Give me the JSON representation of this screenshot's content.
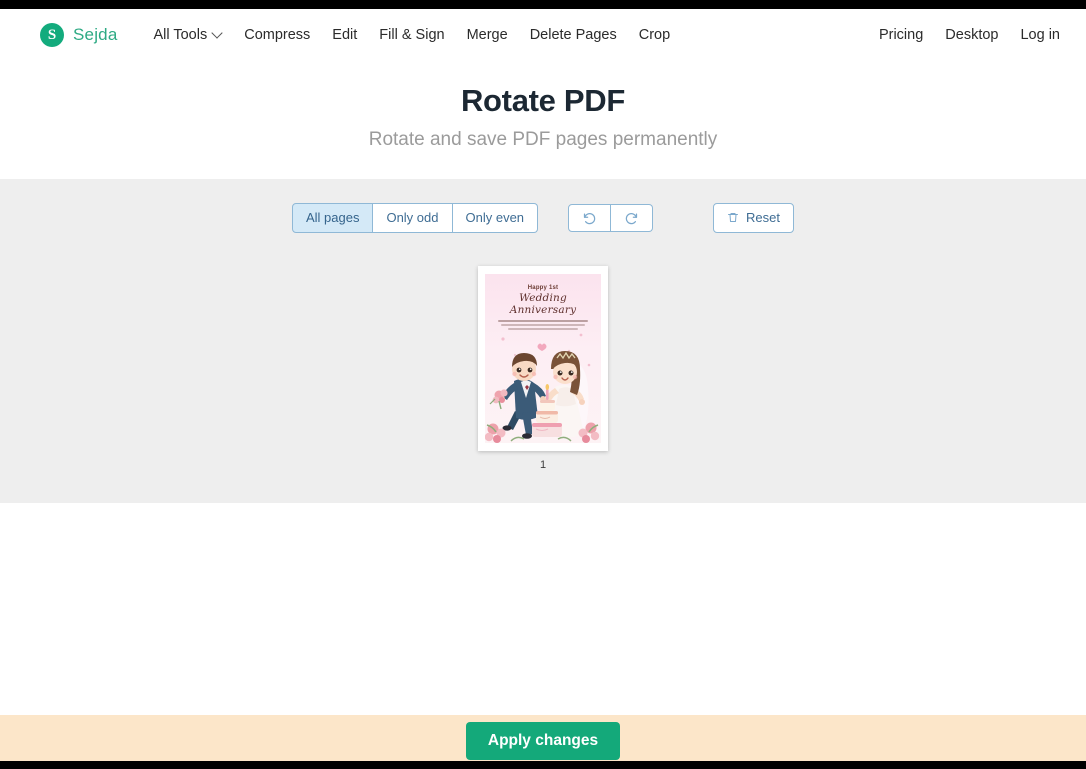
{
  "brand": {
    "mark": "S",
    "name": "Sejda",
    "logo_color": "#13ab7d"
  },
  "nav": {
    "left": [
      {
        "label": "All Tools",
        "has_dropdown": true,
        "icon": "chevron-down-icon"
      },
      {
        "label": "Compress",
        "has_dropdown": false
      },
      {
        "label": "Edit",
        "has_dropdown": false
      },
      {
        "label": "Fill & Sign",
        "has_dropdown": false
      },
      {
        "label": "Merge",
        "has_dropdown": false
      },
      {
        "label": "Delete Pages",
        "has_dropdown": false
      },
      {
        "label": "Crop",
        "has_dropdown": false
      }
    ],
    "right": [
      {
        "label": "Pricing"
      },
      {
        "label": "Desktop"
      },
      {
        "label": "Log in"
      }
    ]
  },
  "header": {
    "title": "Rotate PDF",
    "subtitle": "Rotate and save PDF pages permanently"
  },
  "toolbar": {
    "page_filters": [
      {
        "label": "All pages",
        "active": true
      },
      {
        "label": "Only odd",
        "active": false
      },
      {
        "label": "Only even",
        "active": false
      }
    ],
    "rotate_left": {
      "icon": "rotate-counterclockwise-icon",
      "label": ""
    },
    "rotate_right": {
      "icon": "rotate-clockwise-icon",
      "label": ""
    },
    "reset": {
      "label": "Reset",
      "icon": "trash-icon"
    },
    "active_filter_bg": "#d4e9f7",
    "border_color": "#8fb8d6",
    "text_color": "#3f6d94"
  },
  "document": {
    "pages": [
      {
        "number": "1",
        "card": {
          "line1": "Happy 1st",
          "line2": "Wedding Anniversary",
          "body_lines": 3,
          "theme": "pink wedding anniversary card with cartoon bride and groom, tiered cake and roses"
        }
      }
    ]
  },
  "footer": {
    "apply_label": "Apply changes",
    "button_color": "#14a97a",
    "band_color": "#fce6c9"
  }
}
